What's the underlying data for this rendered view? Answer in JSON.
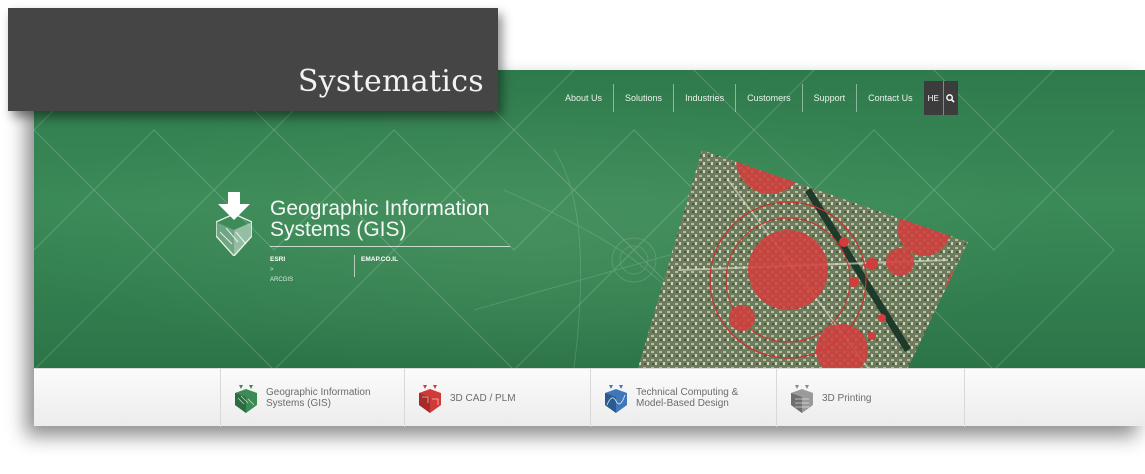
{
  "brand": {
    "logo_text": "Systematics"
  },
  "nav": {
    "items": [
      {
        "label": "About Us",
        "name": "nav-about-us"
      },
      {
        "label": "Solutions",
        "name": "nav-solutions"
      },
      {
        "label": "Industries",
        "name": "nav-industries"
      },
      {
        "label": "Customers",
        "name": "nav-customers"
      },
      {
        "label": "Support",
        "name": "nav-support"
      },
      {
        "label": "Contact Us",
        "name": "nav-contact-us"
      }
    ],
    "language_label": "HE",
    "search_icon": "search-icon"
  },
  "hero": {
    "title_line1": "Geographic Information",
    "title_line2": "Systems (GIS)",
    "icon": "gis-logo-icon",
    "links": {
      "esri_label": "ESRI",
      "arcgis_label": "> ARCGIS",
      "emap_label": "EMAP.CO.IL"
    }
  },
  "tabs": [
    {
      "line1": "Geographic Information",
      "line2": "Systems (GIS)",
      "icon": "gis-tab-icon",
      "color": "#3c8a55"
    },
    {
      "line1": "3D CAD / PLM",
      "line2": "",
      "icon": "cad-tab-icon",
      "color": "#d23a3a"
    },
    {
      "line1": "Technical Computing &",
      "line2": "Model-Based Design",
      "icon": "technical-computing-tab-icon",
      "color": "#3f78b8"
    },
    {
      "line1": "3D Printing",
      "line2": "",
      "icon": "printing-tab-icon",
      "color": "#8a8a8a"
    }
  ],
  "colors": {
    "hero_green": "#2f7a4c",
    "logo_bg": "#454545",
    "tab_text": "#6c6c6c"
  }
}
